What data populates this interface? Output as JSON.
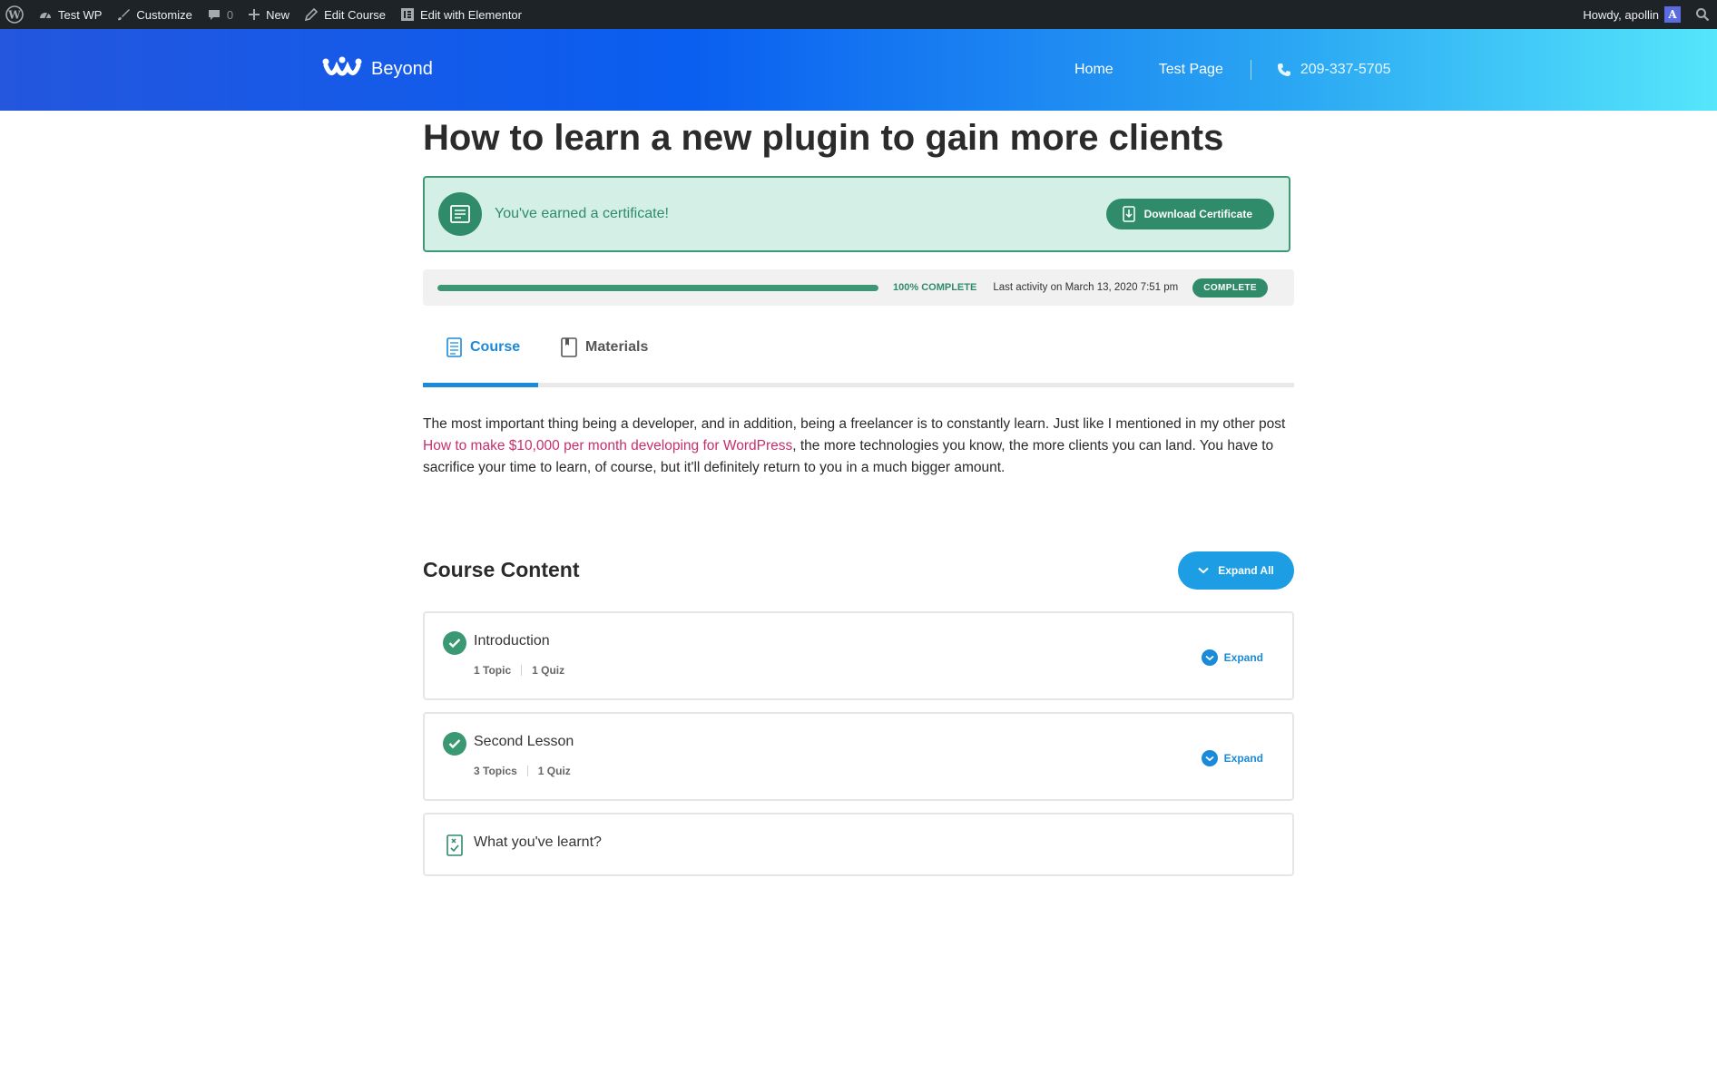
{
  "adminbar": {
    "site": "Test WP",
    "customize": "Customize",
    "comments": "0",
    "new": "New",
    "edit_course": "Edit Course",
    "edit_elementor": "Edit with Elementor",
    "howdy": "Howdy, apollin",
    "avatar_letter": "A"
  },
  "header": {
    "logo_text": "Beyond",
    "nav": [
      "Home",
      "Test Page"
    ],
    "phone": "209-337-5705"
  },
  "course": {
    "title": "How to learn a new plugin to gain more clients",
    "certificate_text": "You've earned a certificate!",
    "download_label": "Download Certificate",
    "progress_percent": 100,
    "progress_label": "100% COMPLETE",
    "last_activity": "Last activity on March 13, 2020 7:51 pm",
    "status_badge": "COMPLETE",
    "tabs": [
      "Course",
      "Materials"
    ],
    "description_1": "The most important thing being a developer, and in addition, being a freelancer is to constantly learn. Just like I mentioned in my other post ",
    "description_link": "How to make $10,000 per month developing for WordPress",
    "description_2": ", the more technologies you know, the more clients you can land. You have to sacrifice your time to learn, of course, but it'll definitely return to you in a much bigger amount."
  },
  "content": {
    "heading": "Course Content",
    "expand_all": "Expand All",
    "lessons": [
      {
        "title": "Introduction",
        "topics": "1 Topic",
        "quiz": "1 Quiz",
        "expand": "Expand"
      },
      {
        "title": "Second Lesson",
        "topics": "3 Topics",
        "quiz": "1 Quiz",
        "expand": "Expand"
      }
    ],
    "final_quiz": "What you've learnt?"
  },
  "colors": {
    "accent_blue": "#1b8ad8",
    "success_green": "#2f8b69",
    "link_pink": "#c72f6b"
  },
  "icons": [
    "wordpress-logo-icon",
    "dashboard-icon",
    "brush-icon",
    "comment-icon",
    "plus-icon",
    "pencil-icon",
    "elementor-icon",
    "search-icon",
    "phone-icon",
    "certificate-icon",
    "download-icon",
    "document-icon",
    "book-icon",
    "check-icon",
    "chevron-down-icon",
    "quiz-icon"
  ]
}
